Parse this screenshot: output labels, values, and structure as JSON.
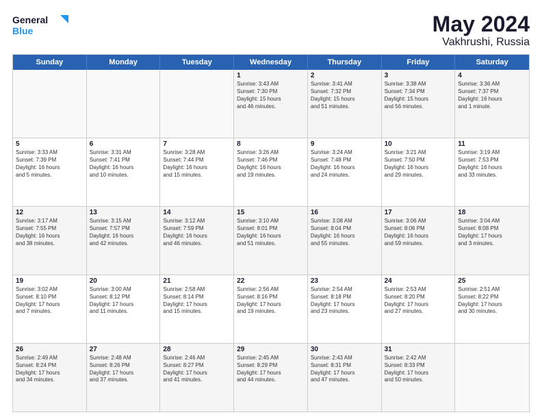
{
  "logo": {
    "line1": "General",
    "line2": "Blue"
  },
  "title": {
    "month": "May 2024",
    "location": "Vakhrushi, Russia"
  },
  "weekdays": [
    "Sunday",
    "Monday",
    "Tuesday",
    "Wednesday",
    "Thursday",
    "Friday",
    "Saturday"
  ],
  "rows": [
    [
      {
        "day": "",
        "text": "",
        "empty": true
      },
      {
        "day": "",
        "text": "",
        "empty": true
      },
      {
        "day": "",
        "text": "",
        "empty": true
      },
      {
        "day": "1",
        "text": "Sunrise: 3:43 AM\nSunset: 7:30 PM\nDaylight: 15 hours\nand 46 minutes."
      },
      {
        "day": "2",
        "text": "Sunrise: 3:41 AM\nSunset: 7:32 PM\nDaylight: 15 hours\nand 51 minutes."
      },
      {
        "day": "3",
        "text": "Sunrise: 3:38 AM\nSunset: 7:34 PM\nDaylight: 15 hours\nand 56 minutes."
      },
      {
        "day": "4",
        "text": "Sunrise: 3:36 AM\nSunset: 7:37 PM\nDaylight: 16 hours\nand 1 minute."
      }
    ],
    [
      {
        "day": "5",
        "text": "Sunrise: 3:33 AM\nSunset: 7:39 PM\nDaylight: 16 hours\nand 5 minutes."
      },
      {
        "day": "6",
        "text": "Sunrise: 3:31 AM\nSunset: 7:41 PM\nDaylight: 16 hours\nand 10 minutes."
      },
      {
        "day": "7",
        "text": "Sunrise: 3:28 AM\nSunset: 7:44 PM\nDaylight: 16 hours\nand 15 minutes."
      },
      {
        "day": "8",
        "text": "Sunrise: 3:26 AM\nSunset: 7:46 PM\nDaylight: 16 hours\nand 19 minutes."
      },
      {
        "day": "9",
        "text": "Sunrise: 3:24 AM\nSunset: 7:48 PM\nDaylight: 16 hours\nand 24 minutes."
      },
      {
        "day": "10",
        "text": "Sunrise: 3:21 AM\nSunset: 7:50 PM\nDaylight: 16 hours\nand 29 minutes."
      },
      {
        "day": "11",
        "text": "Sunrise: 3:19 AM\nSunset: 7:53 PM\nDaylight: 16 hours\nand 33 minutes."
      }
    ],
    [
      {
        "day": "12",
        "text": "Sunrise: 3:17 AM\nSunset: 7:55 PM\nDaylight: 16 hours\nand 38 minutes."
      },
      {
        "day": "13",
        "text": "Sunrise: 3:15 AM\nSunset: 7:57 PM\nDaylight: 16 hours\nand 42 minutes."
      },
      {
        "day": "14",
        "text": "Sunrise: 3:12 AM\nSunset: 7:59 PM\nDaylight: 16 hours\nand 46 minutes."
      },
      {
        "day": "15",
        "text": "Sunrise: 3:10 AM\nSunset: 8:01 PM\nDaylight: 16 hours\nand 51 minutes."
      },
      {
        "day": "16",
        "text": "Sunrise: 3:08 AM\nSunset: 8:04 PM\nDaylight: 16 hours\nand 55 minutes."
      },
      {
        "day": "17",
        "text": "Sunrise: 3:06 AM\nSunset: 8:06 PM\nDaylight: 16 hours\nand 59 minutes."
      },
      {
        "day": "18",
        "text": "Sunrise: 3:04 AM\nSunset: 8:08 PM\nDaylight: 17 hours\nand 3 minutes."
      }
    ],
    [
      {
        "day": "19",
        "text": "Sunrise: 3:02 AM\nSunset: 8:10 PM\nDaylight: 17 hours\nand 7 minutes."
      },
      {
        "day": "20",
        "text": "Sunrise: 3:00 AM\nSunset: 8:12 PM\nDaylight: 17 hours\nand 11 minutes."
      },
      {
        "day": "21",
        "text": "Sunrise: 2:58 AM\nSunset: 8:14 PM\nDaylight: 17 hours\nand 15 minutes."
      },
      {
        "day": "22",
        "text": "Sunrise: 2:56 AM\nSunset: 8:16 PM\nDaylight: 17 hours\nand 19 minutes."
      },
      {
        "day": "23",
        "text": "Sunrise: 2:54 AM\nSunset: 8:18 PM\nDaylight: 17 hours\nand 23 minutes."
      },
      {
        "day": "24",
        "text": "Sunrise: 2:53 AM\nSunset: 8:20 PM\nDaylight: 17 hours\nand 27 minutes."
      },
      {
        "day": "25",
        "text": "Sunrise: 2:51 AM\nSunset: 8:22 PM\nDaylight: 17 hours\nand 30 minutes."
      }
    ],
    [
      {
        "day": "26",
        "text": "Sunrise: 2:49 AM\nSunset: 8:24 PM\nDaylight: 17 hours\nand 34 minutes."
      },
      {
        "day": "27",
        "text": "Sunrise: 2:48 AM\nSunset: 8:26 PM\nDaylight: 17 hours\nand 37 minutes."
      },
      {
        "day": "28",
        "text": "Sunrise: 2:46 AM\nSunset: 8:27 PM\nDaylight: 17 hours\nand 41 minutes."
      },
      {
        "day": "29",
        "text": "Sunrise: 2:45 AM\nSunset: 8:29 PM\nDaylight: 17 hours\nand 44 minutes."
      },
      {
        "day": "30",
        "text": "Sunrise: 2:43 AM\nSunset: 8:31 PM\nDaylight: 17 hours\nand 47 minutes."
      },
      {
        "day": "31",
        "text": "Sunrise: 2:42 AM\nSunset: 8:33 PM\nDaylight: 17 hours\nand 50 minutes."
      },
      {
        "day": "",
        "text": "",
        "empty": true
      }
    ]
  ]
}
